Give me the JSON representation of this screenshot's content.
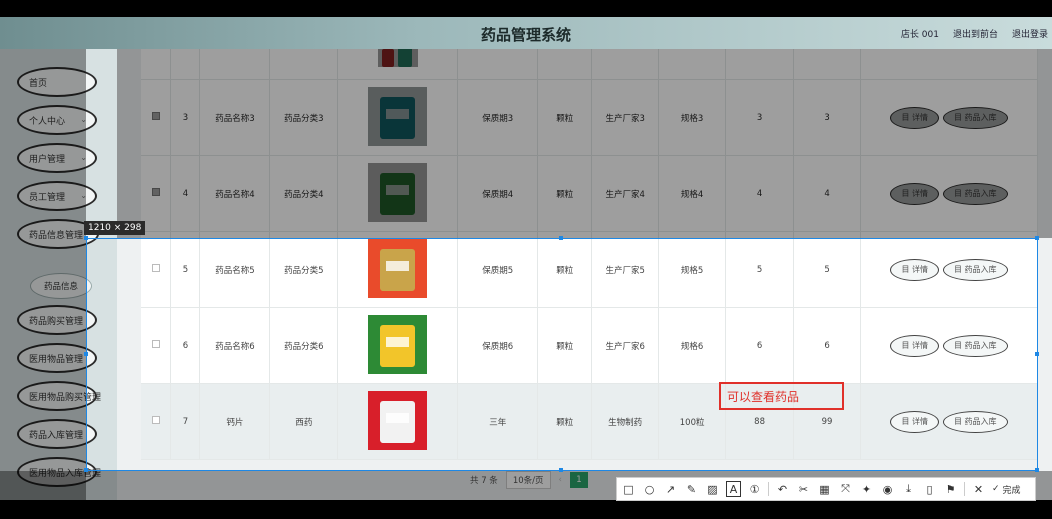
{
  "header": {
    "title": "药品管理系统",
    "user": "店长 001",
    "back_label": "退出到前台",
    "logout_label": "退出登录"
  },
  "sidebar": {
    "items": [
      {
        "label": "首页"
      },
      {
        "label": "个人中心"
      },
      {
        "label": "用户管理"
      },
      {
        "label": "员工管理"
      },
      {
        "label": "药品信息管理"
      },
      {
        "label": "药品信息"
      },
      {
        "label": "药品购买管理"
      },
      {
        "label": "医用物品管理"
      },
      {
        "label": "医用物品购买管理"
      },
      {
        "label": "药品入库管理"
      },
      {
        "label": "医用物品入库管理"
      }
    ]
  },
  "table": {
    "rows": [
      {
        "no": "3",
        "name": "药品名称3",
        "category": "药品分类3",
        "expiry": "保质期3",
        "unit": "颗粒",
        "maker": "生产厂家3",
        "spec": "规格3",
        "a": "3",
        "b": "3"
      },
      {
        "no": "4",
        "name": "药品名称4",
        "category": "药品分类4",
        "expiry": "保质期4",
        "unit": "颗粒",
        "maker": "生产厂家4",
        "spec": "规格4",
        "a": "4",
        "b": "4"
      },
      {
        "no": "5",
        "name": "药品名称5",
        "category": "药品分类5",
        "expiry": "保质期5",
        "unit": "颗粒",
        "maker": "生产厂家5",
        "spec": "规格5",
        "a": "5",
        "b": "5"
      },
      {
        "no": "6",
        "name": "药品名称6",
        "category": "药品分类6",
        "expiry": "保质期6",
        "unit": "颗粒",
        "maker": "生产厂家6",
        "spec": "规格6",
        "a": "6",
        "b": "6"
      },
      {
        "no": "7",
        "name": "钙片",
        "category": "西药",
        "expiry": "三年",
        "unit": "颗粒",
        "maker": "生物制药",
        "spec": "100粒",
        "a": "88",
        "b": "99"
      }
    ],
    "detail_label": "目 详情",
    "stock_label": "目 药品入库"
  },
  "pager": {
    "total": "共 7 条",
    "page_size": "10条/页",
    "current_page": "1"
  },
  "screenshot_tool": {
    "size_label": "1210 × 298",
    "annotation_text": "可以查看药品",
    "done_label": "完成"
  }
}
